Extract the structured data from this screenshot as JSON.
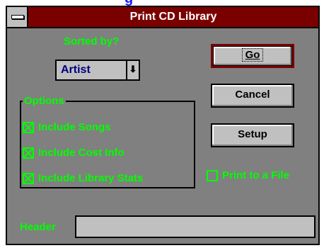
{
  "window": {
    "title": "Print CD Library"
  },
  "sorted_by": {
    "label": "Sorted by?",
    "selected": "Artist"
  },
  "buttons": {
    "go": "Go",
    "cancel": "Cancel",
    "setup": "Setup"
  },
  "options": {
    "label": "Options",
    "items": [
      {
        "label": "Include Songs",
        "checked": true
      },
      {
        "label": "Include Cost Info",
        "checked": true
      },
      {
        "label": "Include Library Stats",
        "checked": true
      }
    ]
  },
  "print_to_file": {
    "label": "Print to a File",
    "checked": false
  },
  "header": {
    "label": "Header",
    "value": ""
  },
  "colors": {
    "titlebar": "#7a0000",
    "label_green": "#00ff00",
    "window_bg": "#808080",
    "control_gray": "#c0c0c0"
  }
}
